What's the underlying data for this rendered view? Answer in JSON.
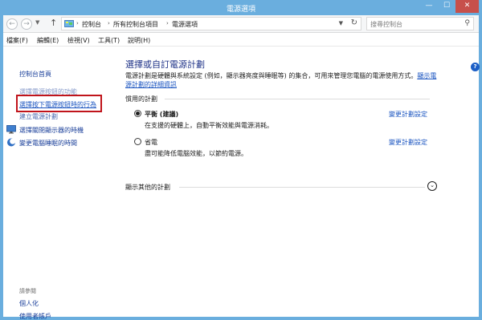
{
  "window": {
    "title": "電源選項",
    "controls": {
      "minimize": "—",
      "maximize": "☐",
      "close": "✕"
    }
  },
  "address": {
    "crumbs": [
      "控制台",
      "所有控制台項目",
      "電源選項"
    ],
    "search_placeholder": "搜尋控制台"
  },
  "menu": [
    "檔案(F)",
    "編輯(E)",
    "檢視(V)",
    "工具(T)",
    "說明(H)"
  ],
  "sidebar": {
    "links": [
      "控制台首頁",
      "選擇電源按鈕的功能",
      "選擇按下電源按鈕時的行為",
      "建立電源計劃"
    ],
    "icon_links": [
      {
        "label": "選擇關閉顯示器的時機",
        "icon": "display-icon"
      },
      {
        "label": "變更電腦睡眠的時間",
        "icon": "moon-icon"
      }
    ],
    "see_also_header": "請參閱",
    "see_also": [
      "個人化",
      "使用者帳戶"
    ]
  },
  "main": {
    "title": "選擇或自訂電源計劃",
    "description": "電源計劃是硬體與系統設定 (例如，顯示器亮度與睡眠等) 的集合，可用來管理您電腦的電源使用方式。",
    "description_link": "顯示電源計劃的詳細資訊",
    "plans_header": "慣用的計劃",
    "plans": [
      {
        "name": "平衡 (建議)",
        "desc": "在支援的硬體上，自動平衡效能與電源消耗。",
        "link": "變更計劃設定",
        "selected": true
      },
      {
        "name": "省電",
        "desc": "盡可能降低電腦效能，以節約電源。",
        "link": "變更計劃設定",
        "selected": false
      }
    ],
    "more_plans": "顯示其他的計劃"
  }
}
